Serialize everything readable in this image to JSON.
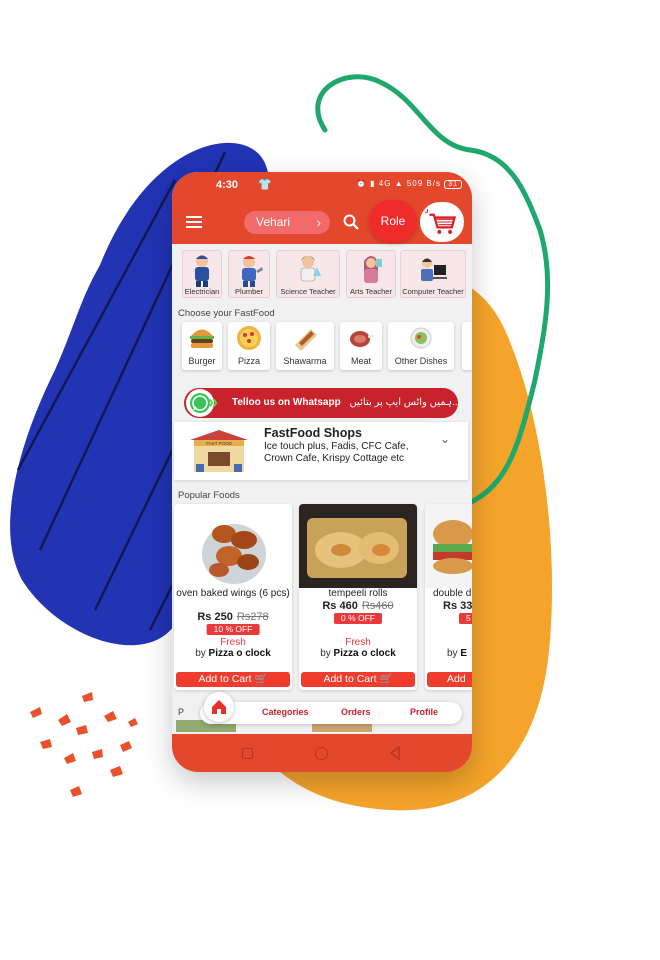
{
  "status_bar": {
    "time": "4:30",
    "indicators": "⏰ ▮ 4G ▲ 509 B/s",
    "battery": "31"
  },
  "header": {
    "location": "Vehari",
    "role_label": "Role",
    "cart_badge": "0"
  },
  "services": [
    {
      "label": "Electrician"
    },
    {
      "label": "Plumber"
    },
    {
      "label": "Science Teacher"
    },
    {
      "label": "Arts Teacher"
    },
    {
      "label": "Computer Teacher"
    }
  ],
  "fastfood_section": {
    "title": "Choose your FastFood"
  },
  "fastfood_categories": [
    {
      "label": "Burger"
    },
    {
      "label": "Pizza"
    },
    {
      "label": "Shawarma"
    },
    {
      "label": "Meat"
    },
    {
      "label": "Other Dishes"
    }
  ],
  "whatsapp_banner": {
    "text": "Telloo us on Whatsapp",
    "urdu_text": "ہمیں واٹس ایپ پر بتائیں..."
  },
  "shops_card": {
    "title": "FastFood Shops",
    "description": "Ice touch plus, Fadis, CFC Cafe, Crown Cafe, Krispy Cottage etc",
    "sign_text": "FAST FOOD"
  },
  "popular_section": {
    "title": "Popular Foods"
  },
  "products": [
    {
      "name": "oven baked wings (6 pcs)",
      "price": "Rs 250",
      "old_price": "Rs278",
      "discount": "10 % OFF",
      "fresh": "Fresh",
      "by": "by",
      "shop": "Pizza o clock",
      "cart": "Add to Cart"
    },
    {
      "name": "tempeeli rolls",
      "price": "Rs 460",
      "old_price": "Rs460",
      "discount": "0 % OFF",
      "fresh": "Fresh",
      "by": "by",
      "shop": "Pizza o clock",
      "cart": "Add to Cart"
    },
    {
      "name": "double d",
      "price": "Rs 33",
      "old_price": "",
      "discount": "5",
      "fresh": "",
      "by": "by",
      "shop": "E",
      "cart": "Add"
    }
  ],
  "bottom_nav": {
    "peek": "P",
    "categories": "Categories",
    "orders": "Orders",
    "profile": "Profile"
  },
  "colors": {
    "primary": "#e3472c",
    "accent": "#ef2b2b",
    "blob_blue": "#2233b4",
    "blob_orange": "#f4a42a",
    "ring_green": "#1ea86c"
  }
}
